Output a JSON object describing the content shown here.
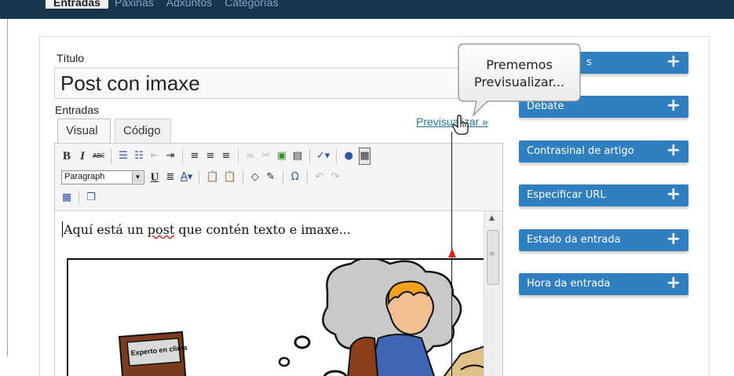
{
  "topnav": {
    "tabs": [
      "Entradas",
      "Páxinas",
      "Adxuntos",
      "Categorías"
    ]
  },
  "form": {
    "title_label": "Título",
    "title_value": "Post con imaxe",
    "entries_label": "Entradas",
    "tab_visual": "Visual",
    "tab_code": "Código",
    "preview_link": "Previsualizar »"
  },
  "toolbar": {
    "row1": [
      "bold-icon",
      "italic-icon",
      "strikethrough-icon",
      "bullet-list-icon",
      "numbered-list-icon",
      "outdent-icon",
      "indent-icon",
      "align-left-icon",
      "align-center-icon",
      "align-right-icon",
      "link-icon",
      "unlink-icon",
      "insert-image-icon",
      "page-break-icon",
      "spellcheck-icon",
      "help-icon",
      "kitchen-sink-icon"
    ],
    "format_value": "Paragraph",
    "row2": [
      "underline-icon",
      "justify-icon",
      "text-color-icon",
      "paste-text-icon",
      "paste-word-icon",
      "remove-format-icon",
      "cleanup-icon",
      "special-char-icon",
      "undo-icon",
      "redo-icon"
    ],
    "row3": [
      "table-icon",
      "media-icon"
    ]
  },
  "editor": {
    "text_before": "Aquí está un ",
    "text_misspelled": "post",
    "text_after": " que contén texto e imaxe...",
    "image_caption": "Experto en clima"
  },
  "sidebar": {
    "boxes": [
      {
        "label": "s"
      },
      {
        "label": "Debate"
      },
      {
        "label": "Contrasinal de artigo"
      },
      {
        "label": "Especificar URL"
      },
      {
        "label": "Estado da entrada"
      },
      {
        "label": "Hora da entrada"
      }
    ],
    "plus_symbol": "+"
  },
  "callout": {
    "line1": "Prememos",
    "line2": "Previsualizar..."
  },
  "colors": {
    "nav_bg": "#19344d",
    "box_blue": "#2f7fc1",
    "link_blue": "#21759b",
    "arrow_red": "#e0201b"
  }
}
